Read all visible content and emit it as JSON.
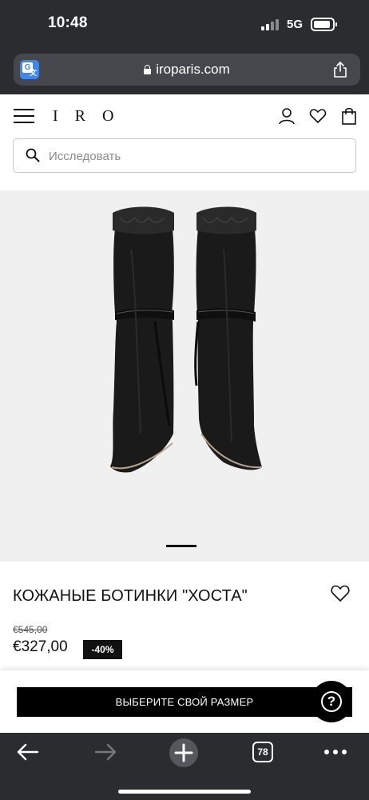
{
  "status_bar": {
    "time": "10:48",
    "network": "5G"
  },
  "browser": {
    "url": "iroparis.com",
    "translate_icon": "translate-icon",
    "share_icon": "share-icon",
    "tabs_count": "78"
  },
  "site_header": {
    "logo": "IRO",
    "icons": [
      "menu-icon",
      "account-icon",
      "heart-icon",
      "shopping-bag-icon"
    ],
    "search": {
      "placeholder": "Исследовать"
    }
  },
  "product": {
    "title": "КОЖАНЫЕ БОТИНКИ \"ХОСТА\"",
    "old_price": "€545,00",
    "new_price": "€327,00",
    "discount": "-40%",
    "image_slide": 1,
    "image_slides_total": 1
  },
  "actions": {
    "select_size_label": "ВЫБЕРИТЕ СВОЙ РАЗМЕР",
    "help_label": "?"
  },
  "colors": {
    "browser_chrome": "#2b2c30",
    "address_bar": "#46474c",
    "image_bg": "#f0f0f0",
    "button": "#000000",
    "accent_translate": "#3d88ec"
  }
}
